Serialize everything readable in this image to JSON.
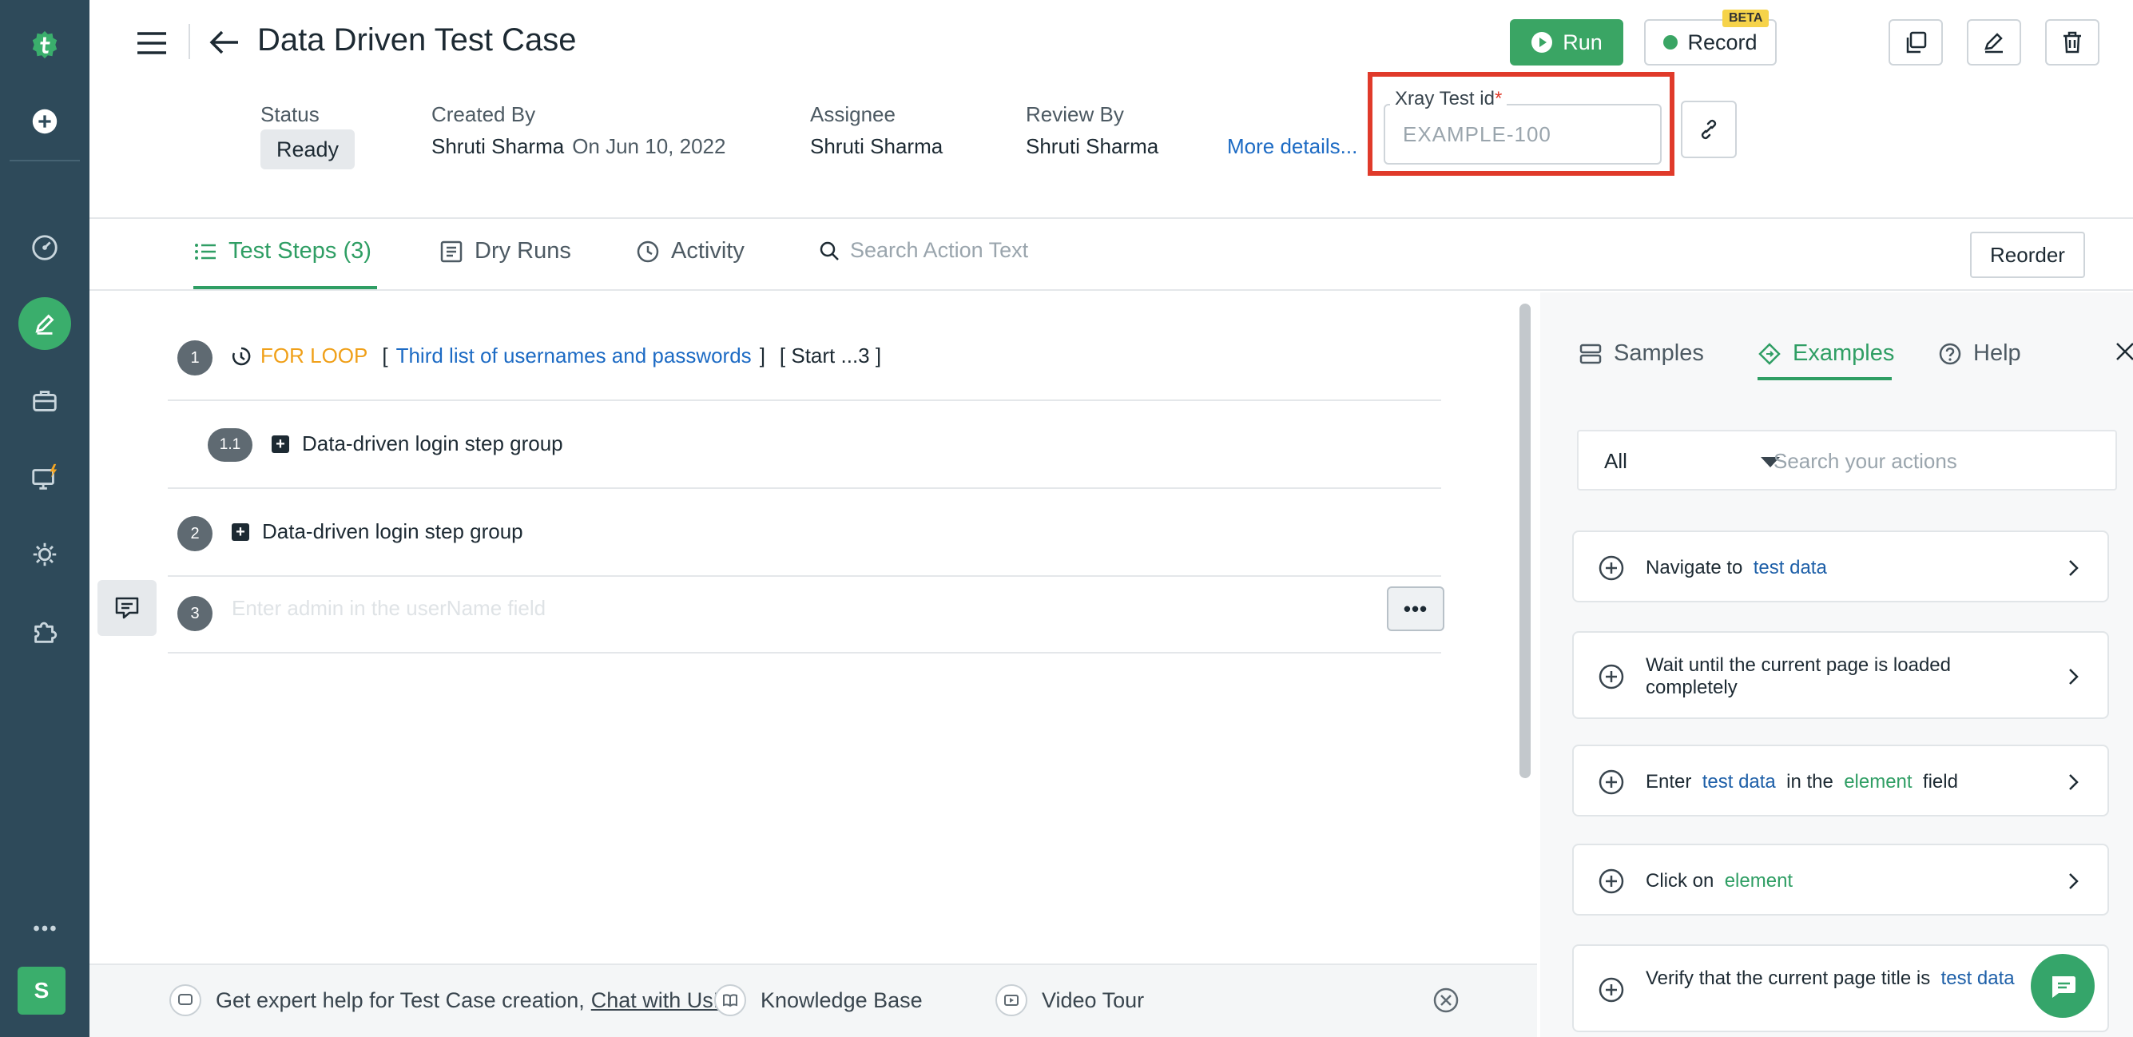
{
  "header": {
    "title": "Data Driven Test Case",
    "run_label": "Run",
    "record_label": "Record",
    "beta_label": "BETA",
    "status": {
      "label": "Status",
      "value": "Ready"
    },
    "created_by": {
      "label": "Created By",
      "value": "Shruti Sharma",
      "date": "On Jun 10, 2022"
    },
    "assignee": {
      "label": "Assignee",
      "value": "Shruti Sharma"
    },
    "review_by": {
      "label": "Review By",
      "value": "Shruti Sharma"
    },
    "more_details": "More details...",
    "xray": {
      "label": "Xray Test id",
      "required_mark": "*",
      "value": "",
      "placeholder": "EXAMPLE-100"
    }
  },
  "tabs": {
    "items": [
      {
        "label": "Test Steps (3)",
        "icon": "list-icon",
        "active": true
      },
      {
        "label": "Dry Runs",
        "icon": "dry-runs-icon",
        "active": false
      },
      {
        "label": "Activity",
        "icon": "clock-icon",
        "active": false
      }
    ],
    "search_placeholder": "Search Action Text",
    "reorder_label": "Reorder"
  },
  "steps": {
    "items": [
      {
        "number": "1",
        "keyword": "FOR LOOP",
        "open_bracket": "[",
        "list_name": "Third list of usernames and passwords",
        "close_bracket": "]",
        "range": "[ Start ...3 ]"
      },
      {
        "number": "1.1",
        "text": "Data-driven login step group"
      },
      {
        "number": "2",
        "text": "Data-driven login step group"
      },
      {
        "number": "3",
        "placeholder": "Enter admin in the userName field"
      }
    ],
    "more_actions": "•••"
  },
  "panel": {
    "tabs": [
      {
        "label": "Samples",
        "icon": "samples-icon",
        "active": false
      },
      {
        "label": "Examples",
        "icon": "examples-icon",
        "active": true
      },
      {
        "label": "Help",
        "icon": "help-icon",
        "active": false
      }
    ],
    "filter": {
      "selected": "All",
      "search_placeholder": "Search your actions"
    },
    "cards": [
      {
        "parts": [
          [
            "Navigate to",
            "plain"
          ],
          [
            "test data",
            "blue"
          ]
        ]
      },
      {
        "parts": [
          [
            "Wait until the current page is loaded completely",
            "plain"
          ]
        ]
      },
      {
        "parts": [
          [
            "Enter",
            "plain"
          ],
          [
            "test data",
            "blue"
          ],
          [
            "in the",
            "plain"
          ],
          [
            "element",
            "green"
          ],
          [
            "field",
            "plain"
          ]
        ]
      },
      {
        "parts": [
          [
            "Click on",
            "plain"
          ],
          [
            "element",
            "green"
          ]
        ]
      },
      {
        "parts": [
          [
            "Verify that the current page title is",
            "plain"
          ],
          [
            "test data",
            "blue"
          ]
        ]
      }
    ]
  },
  "helpbar": {
    "prefix": "Get expert help for Test Case creation,",
    "chat_link": "Chat with Us!",
    "knowledge_base": "Knowledge Base",
    "video_tour": "Video Tour"
  },
  "user": {
    "avatar_initial": "S"
  },
  "colors": {
    "accent": "#2f9e64",
    "rail": "#2e4a5a",
    "highlight": "#e03a2a",
    "link": "#1d6bc4",
    "loop": "#f0a019"
  }
}
